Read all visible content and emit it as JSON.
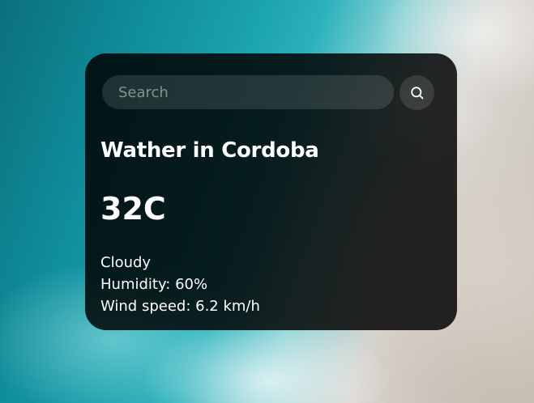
{
  "search": {
    "placeholder": "Search",
    "value": "",
    "button_icon": "search-icon"
  },
  "weather": {
    "title": "Wather in Cordoba",
    "temperature": "32C",
    "description": "Cloudy",
    "humidity": "Humidity: 60%",
    "wind_speed": "Wind speed: 6.2 km/h"
  },
  "colors": {
    "card_background": "#1e1e1e",
    "text": "#ffffff",
    "input_background": "#3a3a3a"
  }
}
